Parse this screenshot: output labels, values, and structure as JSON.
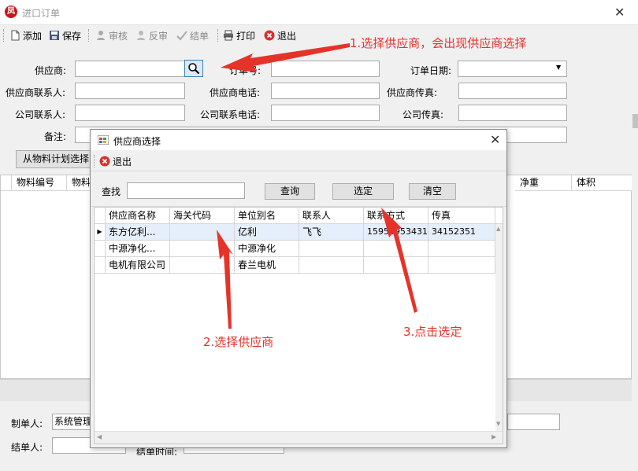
{
  "window": {
    "icon_text": "凤",
    "title": "进口订单",
    "close": "✕"
  },
  "toolbar": {
    "add": "添加",
    "save": "保存",
    "review": "审核",
    "unreview": "反审",
    "close_order": "结单",
    "print": "打印",
    "exit": "退出"
  },
  "form": {
    "supplier_label": "供应商:",
    "order_no_label": "订单号:",
    "order_date_label": "订单日期:",
    "supplier_contact_label": "供应商联系人:",
    "supplier_phone_label": "供应商电话:",
    "supplier_fax_label": "供应商传真:",
    "company_contact_label": "公司联系人:",
    "company_phone_label": "公司联系电话:",
    "company_fax_label": "公司传真:",
    "remark_label": "备注:",
    "material_plan_button": "从物料计划选择"
  },
  "main_grid": {
    "columns": [
      "物料编号",
      "物料",
      "净重",
      "体积"
    ]
  },
  "footer": {
    "creator_label": "制单人:",
    "creator_value": "系统管理",
    "closer_label": "结单人:",
    "close_time_label": "结单时间:"
  },
  "dialog": {
    "title": "供应商选择",
    "close": "✕",
    "exit": "退出",
    "search_label": "查找",
    "search_value": "",
    "query_button": "查询",
    "select_button": "选定",
    "clear_button": "清空",
    "columns": [
      "供应商名称",
      "海关代码",
      "单位别名",
      "联系人",
      "联系方式",
      "传真"
    ],
    "rows": [
      {
        "name": "东方亿利...",
        "customs": "",
        "alias": "亿利",
        "contact": "飞飞",
        "phone": "15955953431",
        "fax": "34152351"
      },
      {
        "name": "中源净化...",
        "customs": "",
        "alias": "中源净化",
        "contact": "",
        "phone": "",
        "fax": ""
      },
      {
        "name": "电机有限公司",
        "customs": "",
        "alias": "春兰电机",
        "contact": "",
        "phone": "",
        "fax": ""
      }
    ]
  },
  "annotations": {
    "step1": "1.选择供应商，会出现供应商选择",
    "step2": "2.选择供应商",
    "step3": "3.点击选定"
  },
  "colors": {
    "annotation": "#e6332a",
    "selected_row": "#e5eefb",
    "exit_icon": "#d9302c"
  }
}
